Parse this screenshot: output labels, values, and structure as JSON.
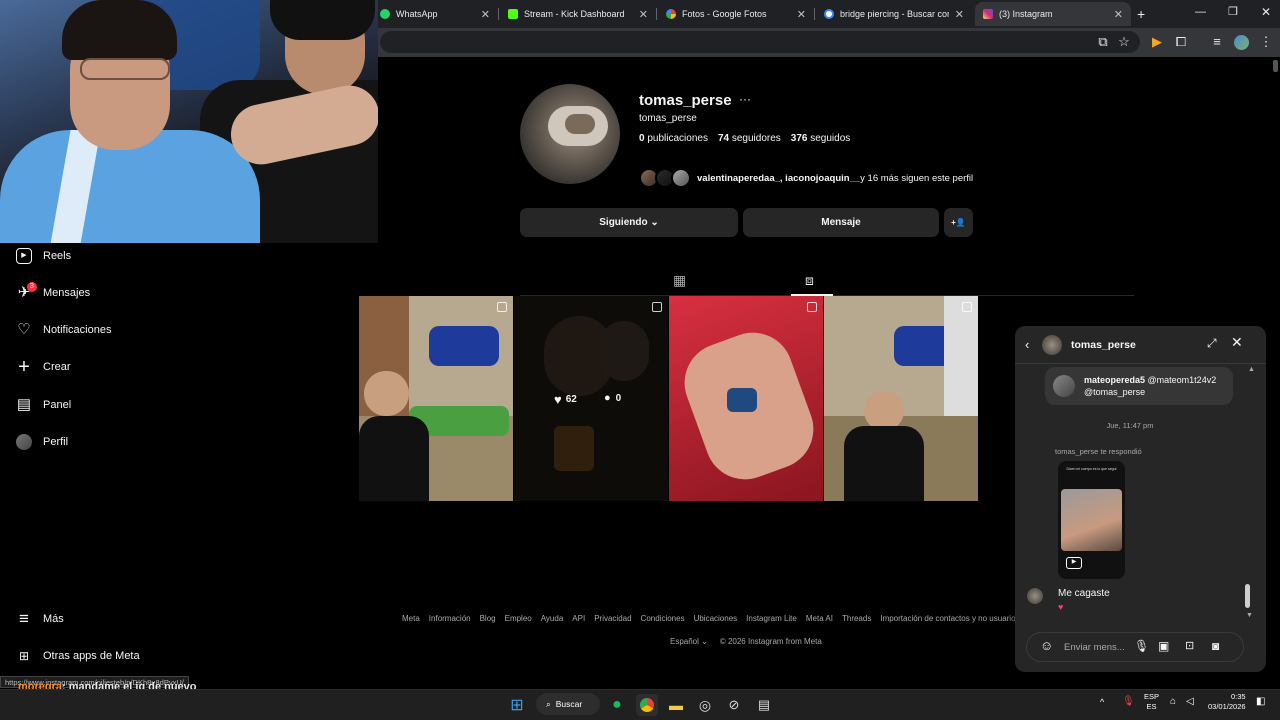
{
  "browser": {
    "tabs": [
      {
        "title": "WhatsApp",
        "color": "#25d366"
      },
      {
        "title": "Stream - Kick Dashboard",
        "color": "#53fc18"
      },
      {
        "title": "Fotos - Google Fotos",
        "color": "#fbbc04"
      },
      {
        "title": "bridge piercing - Buscar con Go",
        "color": "#4285f4"
      },
      {
        "title": "(3) Instagram",
        "color": "#e1306c"
      }
    ],
    "new_tab": "+",
    "close": "✕"
  },
  "sidebar": {
    "items": [
      {
        "label": "Reels",
        "icon": "reels-icon",
        "glyph": "▶"
      },
      {
        "label": "Mensajes",
        "icon": "messages-icon",
        "glyph": "✈",
        "badge": "3"
      },
      {
        "label": "Notificaciones",
        "icon": "heart-icon",
        "glyph": "♡"
      },
      {
        "label": "Crear",
        "icon": "plus-icon",
        "glyph": "+"
      },
      {
        "label": "Panel",
        "icon": "chart-icon",
        "glyph": "▤"
      },
      {
        "label": "Perfil",
        "icon": "avatar",
        "glyph": ""
      }
    ],
    "more": "Más",
    "meta_apps": "Otras apps de Meta"
  },
  "profile": {
    "username": "tomas_perse",
    "more_glyph": "···",
    "full_name": "tomas_perse",
    "stats": {
      "posts_count": "0",
      "posts_label": "publicaciones",
      "followers_count": "74",
      "followers_label": "seguidores",
      "following_count": "376",
      "following_label": "seguidos"
    },
    "followed_by_names": "valentinaperedaa_, iaconojoaquin__",
    "followed_by_rest": " y 16 más siguen este perfil",
    "following_button": "Siguiendo ⌄",
    "message_button": "Mensaje",
    "add_user_glyph": "+👤"
  },
  "grid": {
    "hover_likes": "62",
    "hover_comments": "0"
  },
  "footer": {
    "links": [
      "Meta",
      "Información",
      "Blog",
      "Empleo",
      "Ayuda",
      "API",
      "Privacidad",
      "Condiciones",
      "Ubicaciones",
      "Instagram Lite",
      "Meta AI",
      "Threads",
      "Importación de contactos y no usuarios"
    ],
    "language": "Español ⌄",
    "copyright": "© 2026 Instagram from Meta"
  },
  "chat": {
    "title": "tomas_perse",
    "shared_user": "mateopereda5",
    "shared_text_1": " @mateom1t24v2",
    "shared_text_2": "@tomas_perse",
    "timestamp": "Jue, 11:47 pm",
    "replied_note": "tomas_perse te respondió",
    "reel_caption": "Dicen mi cuerpo es lo que seguí",
    "last_message": "Me cagaste",
    "reaction": "♥",
    "input_placeholder": "Enviar mens..."
  },
  "stream": {
    "status_url": "https://www.instagram.com/piliesteb/p/DKh8u8dPvxU/",
    "chat_user": "moregra",
    "chat_message": ": mandame el ig de nuevo"
  },
  "taskbar": {
    "search_label": "Buscar",
    "lang_top": "ESP",
    "lang_bottom": "ES",
    "time": "0:35",
    "date": "03/01/2026"
  }
}
